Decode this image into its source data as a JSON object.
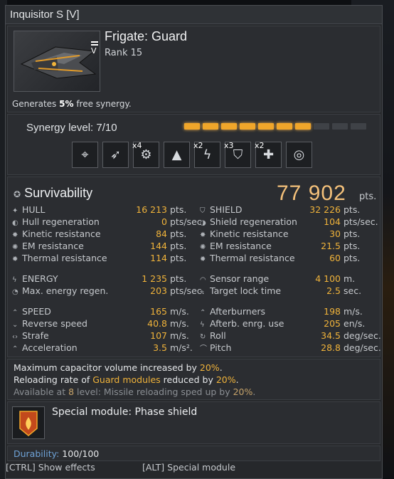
{
  "window": {
    "title": "Inquisitor S [V]"
  },
  "ship": {
    "badge": "V",
    "class_title": "Frigate: Guard",
    "rank": "Rank 15",
    "generates_prefix": "Generates ",
    "generates_value": "5%",
    "generates_suffix": " free synergy."
  },
  "synergy": {
    "label": "Synergy level: 7/10",
    "filled": 7,
    "total": 10,
    "modules": [
      {
        "icon": "targeting-module-icon",
        "mult": ""
      },
      {
        "icon": "missile-module-icon",
        "mult": ""
      },
      {
        "icon": "gear-module-icon",
        "mult": "x4"
      },
      {
        "icon": "arrow-up-module-icon",
        "mult": ""
      },
      {
        "icon": "lightning-module-icon",
        "mult": "x2"
      },
      {
        "icon": "shield-module-icon",
        "mult": "x3"
      },
      {
        "icon": "repair-module-icon",
        "mult": "x2"
      },
      {
        "icon": "crosshair-module-icon",
        "mult": ""
      }
    ]
  },
  "survivability": {
    "title": "Survivability",
    "total": "77 902",
    "total_unit": "pts.",
    "left": [
      {
        "icon": "hull-icon",
        "label": "HULL",
        "value": "16 213",
        "unit": "pts."
      },
      {
        "icon": "hull-regen-icon",
        "label": "Hull regeneration",
        "value": "0",
        "unit": "pts/sec."
      },
      {
        "icon": "kinetic-icon",
        "label": "Kinetic resistance",
        "value": "84",
        "unit": "pts."
      },
      {
        "icon": "em-icon",
        "label": "EM resistance",
        "value": "144",
        "unit": "pts."
      },
      {
        "icon": "thermal-icon",
        "label": "Thermal resistance",
        "value": "114",
        "unit": "pts."
      }
    ],
    "right": [
      {
        "icon": "shield-icon",
        "label": "SHIELD",
        "value": "32 226",
        "unit": "pts."
      },
      {
        "icon": "shield-regen-icon",
        "label": "Shield regeneration",
        "value": "104",
        "unit": "pts/sec."
      },
      {
        "icon": "kinetic-icon",
        "label": "Kinetic resistance",
        "value": "30",
        "unit": "pts."
      },
      {
        "icon": "em-icon",
        "label": "EM resistance",
        "value": "21.5",
        "unit": "pts."
      },
      {
        "icon": "thermal-icon",
        "label": "Thermal resistance",
        "value": "60",
        "unit": "pts."
      }
    ]
  },
  "energy": {
    "left": [
      {
        "icon": "energy-icon",
        "label": "ENERGY",
        "value": "1 235",
        "unit": "pts."
      },
      {
        "icon": "energy-regen-icon",
        "label": "Max. energy regen.",
        "value": "203",
        "unit": "pts/sec."
      }
    ],
    "right": [
      {
        "icon": "sensor-icon",
        "label": "Sensor range",
        "value": "4 100",
        "unit": "m."
      },
      {
        "icon": "target-lock-icon",
        "label": "Target lock time",
        "value": "2.5",
        "unit": "sec."
      }
    ]
  },
  "mobility": {
    "left": [
      {
        "icon": "speed-icon",
        "label": "SPEED",
        "value": "165",
        "unit": "m/s."
      },
      {
        "icon": "reverse-icon",
        "label": "Reverse speed",
        "value": "40.8",
        "unit": "m/s."
      },
      {
        "icon": "strafe-icon",
        "label": "Strafe",
        "value": "107",
        "unit": "m/s."
      },
      {
        "icon": "acceleration-icon",
        "label": "Acceleration",
        "value": "3.5",
        "unit": "m/s²."
      }
    ],
    "right": [
      {
        "icon": "afterburner-icon",
        "label": "Afterburners",
        "value": "198",
        "unit": "m/s."
      },
      {
        "icon": "afterburner-energy-icon",
        "label": "Afterb. enrg. use",
        "value": "205",
        "unit": "en/s."
      },
      {
        "icon": "roll-icon",
        "label": "Roll",
        "value": "34.5",
        "unit": "deg/sec."
      },
      {
        "icon": "pitch-icon",
        "label": "Pitch",
        "value": "28.8",
        "unit": "deg/sec."
      }
    ]
  },
  "bonuses": {
    "line1_a": "Maximum capacitor volume increased by ",
    "line1_v": "20%",
    "line1_b": ".",
    "line2_a": "Reloading rate of ",
    "line2_h": "Guard modules",
    "line2_b": " reduced by ",
    "line2_v": "20%",
    "line2_c": ".",
    "line3_a": "Available at ",
    "line3_h": "8",
    "line3_b": " level: Missile reloading sped up by ",
    "line3_v": "20%",
    "line3_c": "."
  },
  "special": {
    "title": "Special module: Phase shield"
  },
  "durability": {
    "label": "Durability:",
    "value": "100/100"
  },
  "footer": {
    "ctrl": "[CTRL] Show effects",
    "alt": "[ALT] Special module"
  },
  "colors": {
    "accent": "#f0b33a",
    "synergy_on": "#f0a62a",
    "durability_label": "#6fa3d8"
  }
}
